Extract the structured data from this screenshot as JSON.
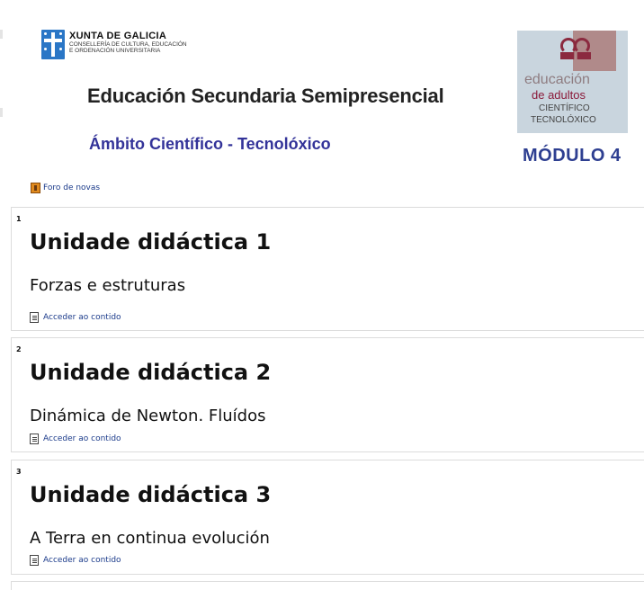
{
  "header": {
    "xunta_name": "XUNTA DE GALICIA",
    "xunta_sub_line1": "CONSELLERÍA DE CULTURA, EDUCACIÓN",
    "xunta_sub_line2": "E ORDENACIÓN UNIVERSITARIA",
    "title": "Educación Secundaria Semipresencial",
    "subtitle": "Ámbito Científico - Tecnolóxico",
    "logo_line1": "educación",
    "logo_line2": "de adultos",
    "logo_line3": "CIENTÍFICO",
    "logo_line4": "TECNOLÓXICO",
    "module": "MÓDULO  4"
  },
  "forum": {
    "label": "Foro de novas",
    "icon": "forum-icon"
  },
  "sections": [
    {
      "number": "1",
      "title": "Unidade didáctica 1",
      "subtitle": "Forzas e estruturas",
      "link": "Acceder ao contido"
    },
    {
      "number": "2",
      "title": "Unidade didáctica 2",
      "subtitle": "Dinámica de Newton. Fluídos",
      "link": "Acceder ao contido"
    },
    {
      "number": "3",
      "title": "Unidade didáctica 3",
      "subtitle": "A Terra en continua evolución",
      "link": "Acceder ao contido"
    }
  ],
  "colors": {
    "subtitle": "#333399",
    "module": "#2e3f91",
    "link": "#1a3a8a",
    "xunta_blue": "#2a76c6"
  }
}
